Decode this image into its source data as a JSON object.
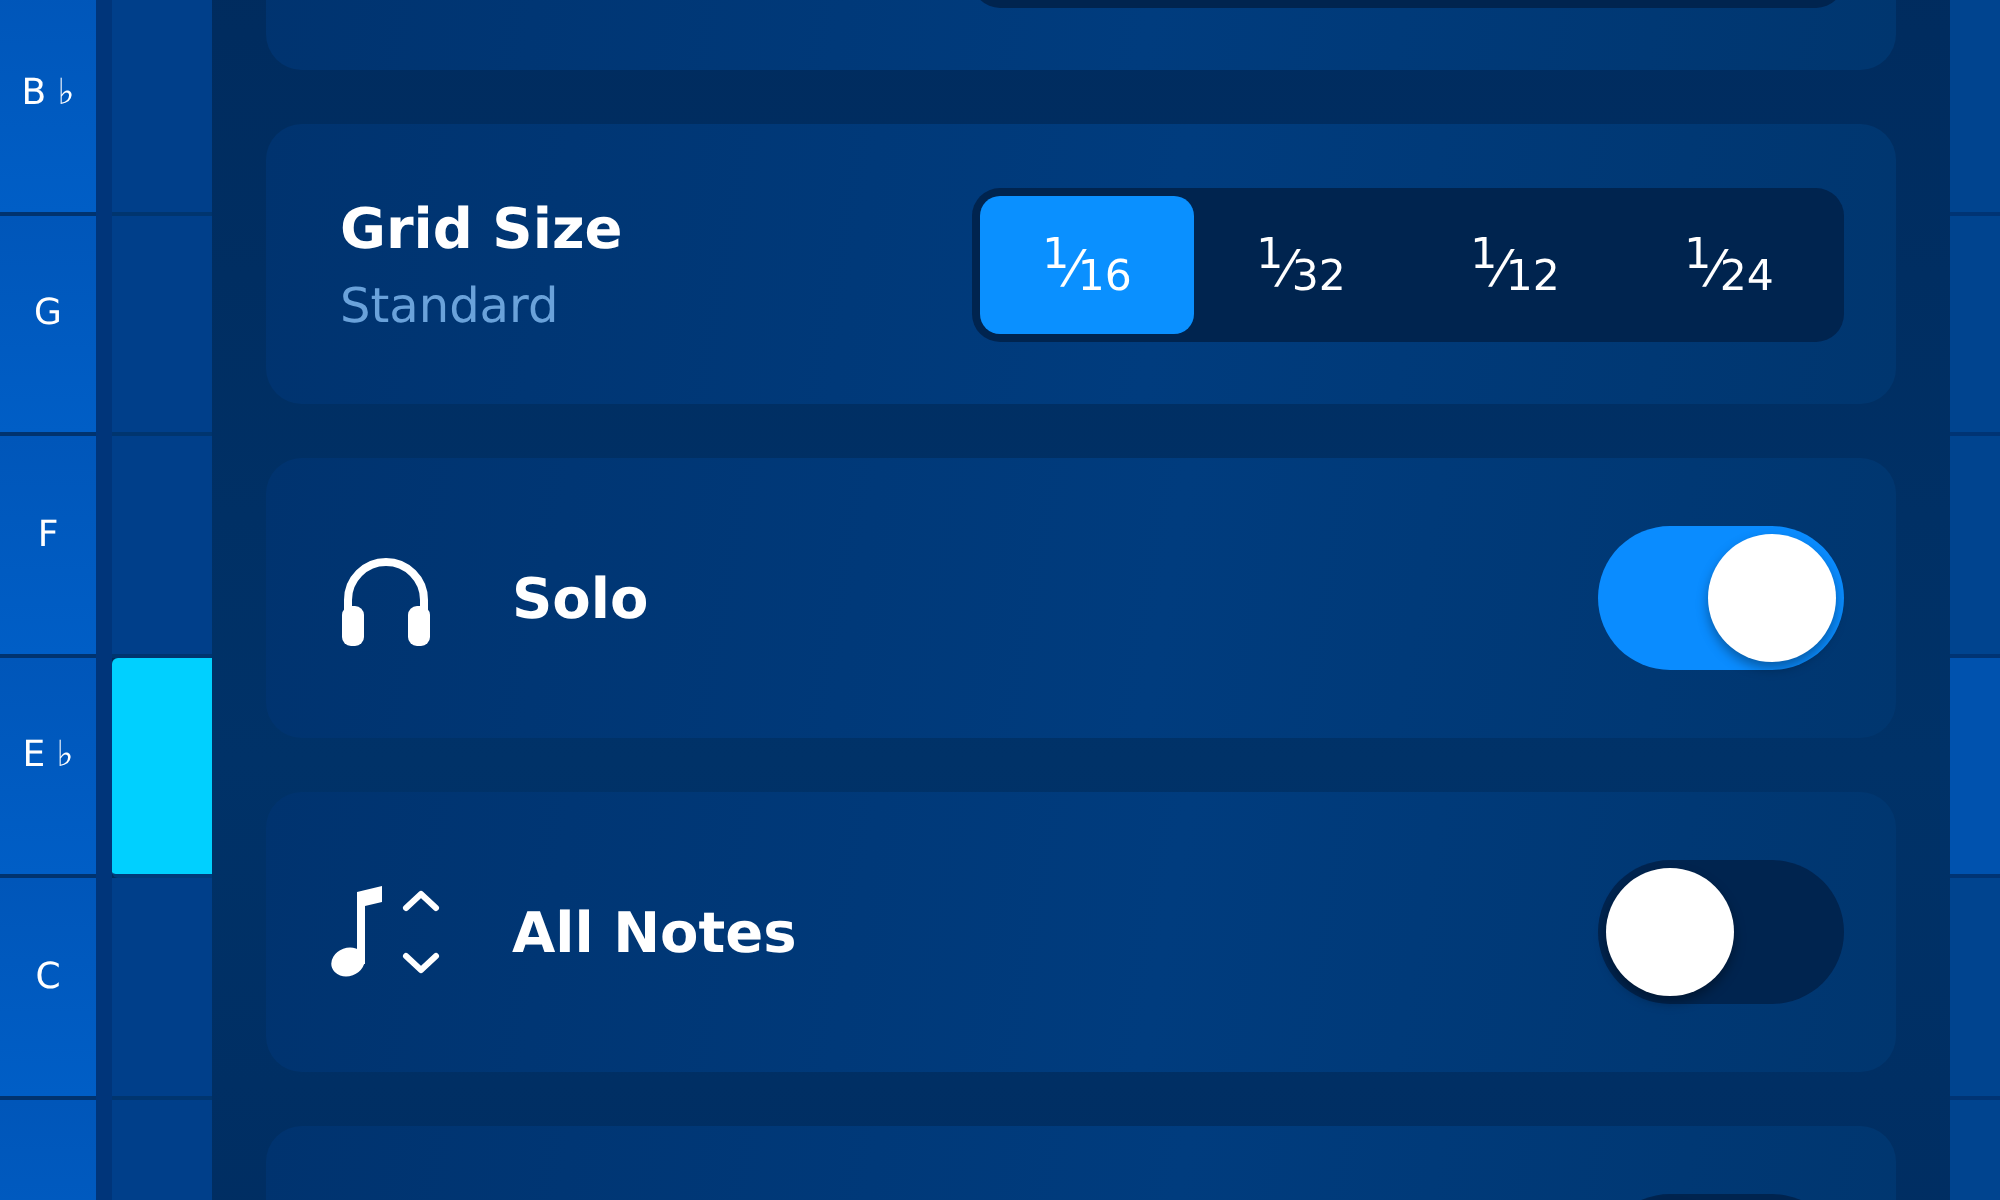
{
  "piano_rows": [
    {
      "label": "B ♭",
      "note": false,
      "highlighted": false
    },
    {
      "label": "G",
      "note": false,
      "highlighted": false
    },
    {
      "label": "F",
      "note": false,
      "highlighted": false
    },
    {
      "label": "E ♭",
      "note": true,
      "highlighted": true
    },
    {
      "label": "C",
      "note": false,
      "highlighted": false
    },
    {
      "note": false,
      "highlighted": false
    }
  ],
  "settings": {
    "cards": [
      {
        "kind": "segmented"
      },
      {
        "kind": "segmented",
        "title": "Grid Size",
        "subtitle": "Standard",
        "options": [
          {
            "label": "$^{1}$⁄$_{16}$",
            "selected": true
          },
          {
            "label": "$^{1}$⁄$_{32}$",
            "selected": false
          },
          {
            "label": "$^{1}$⁄$_{12}$",
            "selected": false
          },
          {
            "label": "$^{1}$⁄$_{24}$",
            "selected": false
          }
        ]
      },
      {
        "kind": "toggle",
        "label": "Solo",
        "on": true
      },
      {
        "kind": "toggle",
        "label": "All Notes",
        "on": false
      },
      {
        "kind": "toggle",
        "on": false
      }
    ]
  }
}
